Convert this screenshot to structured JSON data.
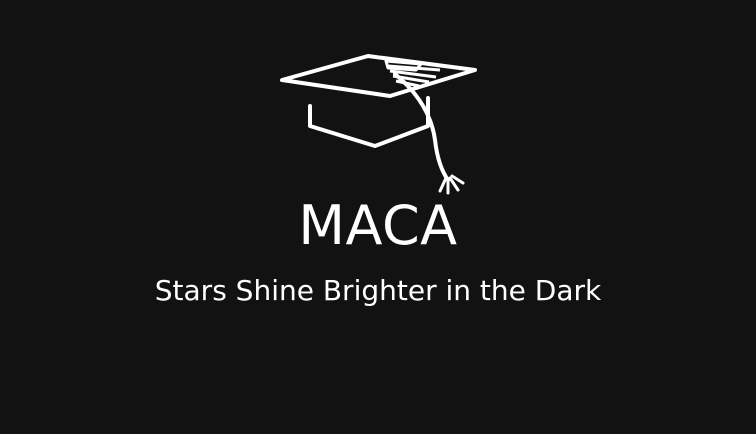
{
  "branding": {
    "title": "MACA",
    "tagline": "Stars Shine Brighter in the Dark",
    "logo_icon": "graduation-cap-icon"
  },
  "colors": {
    "background": "#121212",
    "foreground": "#ffffff"
  }
}
